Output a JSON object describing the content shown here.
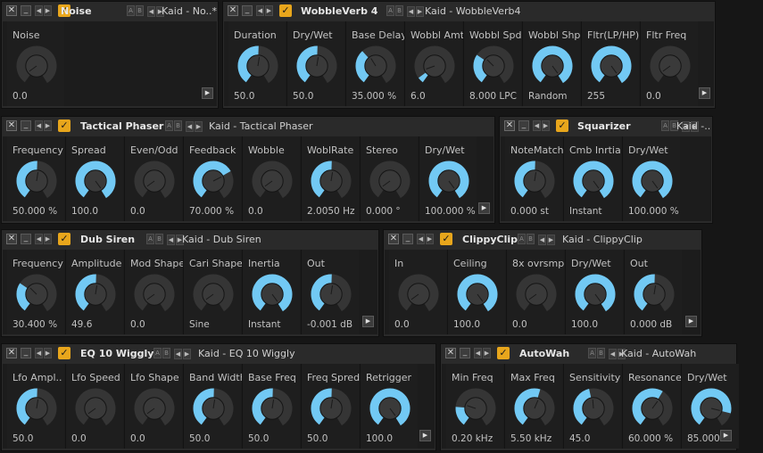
{
  "colors": {
    "accent": "#72c9f4",
    "knob": "#353535",
    "enabled": "#e8a61c"
  },
  "devices": [
    {
      "name": "Noise",
      "preset": "Kaid - No..*",
      "params": [
        {
          "label": "Noise",
          "value": "0.0",
          "level": 0
        }
      ]
    },
    {
      "name": "WobbleVerb 4",
      "preset": "Kaid - WobbleVerb4",
      "params": [
        {
          "label": "Duration",
          "value": "50.0",
          "level": 0.5
        },
        {
          "label": "Dry/Wet",
          "value": "50.0",
          "level": 0.5
        },
        {
          "label": "Base Delay",
          "value": "35.000 %",
          "level": 0.35
        },
        {
          "label": "Wobbl Amt",
          "value": "6.0",
          "level": 0.06
        },
        {
          "label": "Wobbl Spd",
          "value": "8.000 LPC",
          "level": 0.3
        },
        {
          "label": "Wobbl Shp",
          "value": "Random",
          "level": 1
        },
        {
          "label": "Fltr(LP/HP)",
          "value": "255",
          "level": 1
        },
        {
          "label": "Fltr Freq",
          "value": "0.0",
          "level": 0
        }
      ]
    },
    {
      "name": "Tactical Phaser",
      "preset": "Kaid - Tactical Phaser",
      "params": [
        {
          "label": "Frequency",
          "value": "50.000 %",
          "level": 0.5
        },
        {
          "label": "Spread",
          "value": "100.0",
          "level": 1
        },
        {
          "label": "Even/Odd",
          "value": "0.0",
          "level": 0
        },
        {
          "label": "Feedback",
          "value": "70.000 %",
          "level": 0.7
        },
        {
          "label": "Wobble",
          "value": "0.0",
          "level": 0
        },
        {
          "label": "WoblRate",
          "value": "2.0050 Hz",
          "level": 0.5
        },
        {
          "label": "Stereo",
          "value": "0.000 °",
          "level": 0
        },
        {
          "label": "Dry/Wet",
          "value": "100.000 %",
          "level": 1
        }
      ]
    },
    {
      "name": "Squarizer",
      "preset": "Kaid -..",
      "params": [
        {
          "label": "NoteMatch",
          "value": "0.000 st",
          "level": 0.5
        },
        {
          "label": "Cmb Inrtia",
          "value": "Instant",
          "level": 1
        },
        {
          "label": "Dry/Wet",
          "value": "100.000 %",
          "level": 1
        }
      ]
    },
    {
      "name": "Dub Siren",
      "preset": "Kaid - Dub Siren",
      "params": [
        {
          "label": "Frequency",
          "value": "30.400 %",
          "level": 0.3
        },
        {
          "label": "Amplitude",
          "value": "49.6",
          "level": 0.5
        },
        {
          "label": "Mod Shape",
          "value": "0.0",
          "level": 0
        },
        {
          "label": "Cari Shape",
          "value": "Sine",
          "level": 0
        },
        {
          "label": "Inertia",
          "value": "Instant",
          "level": 1
        },
        {
          "label": "Out",
          "value": "-0.001 dB",
          "level": 0.5
        }
      ]
    },
    {
      "name": "ClippyClip",
      "preset": "Kaid - ClippyClip",
      "params": [
        {
          "label": "In",
          "value": "0.0",
          "level": 0
        },
        {
          "label": "Ceiling",
          "value": "100.0",
          "level": 1
        },
        {
          "label": "8x ovrsmpl",
          "value": "0.0",
          "level": 0
        },
        {
          "label": "Dry/Wet",
          "value": "100.0",
          "level": 1
        },
        {
          "label": "Out",
          "value": "0.000 dB",
          "level": 0.5
        }
      ]
    },
    {
      "name": "EQ 10 Wiggly",
      "preset": "Kaid - EQ 10 Wiggly",
      "params": [
        {
          "label": "Lfo Ampl..",
          "value": "50.0",
          "level": 0.5
        },
        {
          "label": "Lfo Speed",
          "value": "0.0",
          "level": 0
        },
        {
          "label": "Lfo Shape",
          "value": "0.0",
          "level": 0
        },
        {
          "label": "Band Width",
          "value": "50.0",
          "level": 0.5
        },
        {
          "label": "Base Freq",
          "value": "50.0",
          "level": 0.5
        },
        {
          "label": "Freq Spred",
          "value": "50.0",
          "level": 0.5
        },
        {
          "label": "Retrigger",
          "value": "100.0",
          "level": 1
        }
      ]
    },
    {
      "name": "AutoWah",
      "preset": "Kaid - AutoWah",
      "params": [
        {
          "label": "Min Freq",
          "value": "0.20 kHz",
          "level": 0.2
        },
        {
          "label": "Max Freq",
          "value": "5.50 kHz",
          "level": 0.55
        },
        {
          "label": "Sensitivity",
          "value": "45.0",
          "level": 0.45
        },
        {
          "label": "Resonance",
          "value": "60.000 %",
          "level": 0.6
        },
        {
          "label": "Dry/Wet",
          "value": "85.000 %",
          "level": 0.85
        }
      ]
    }
  ]
}
